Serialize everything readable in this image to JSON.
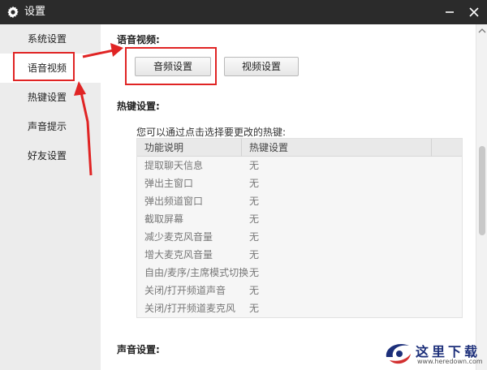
{
  "window": {
    "title": "设置"
  },
  "sidebar": {
    "items": [
      {
        "label": "系统设置",
        "active": false
      },
      {
        "label": "语音视频",
        "active": true
      },
      {
        "label": "热键设置",
        "active": false
      },
      {
        "label": "声音提示",
        "active": false
      },
      {
        "label": "好友设置",
        "active": false
      }
    ]
  },
  "voice_video": {
    "title": "语音视频:",
    "audio_button": "音频设置",
    "video_button": "视频设置"
  },
  "hotkeys": {
    "title": "热键设置:",
    "hint": "您可以通过点击选择要更改的热键:",
    "columns": [
      "功能说明",
      "热键设置"
    ],
    "rows": [
      {
        "function": "提取聊天信息",
        "key": "无"
      },
      {
        "function": "弹出主窗口",
        "key": "无"
      },
      {
        "function": "弹出频道窗口",
        "key": "无"
      },
      {
        "function": "截取屏幕",
        "key": "无"
      },
      {
        "function": "减少麦克风音量",
        "key": "无"
      },
      {
        "function": "增大麦克风音量",
        "key": "无"
      },
      {
        "function": "自由/麦序/主席模式切换",
        "key": "无"
      },
      {
        "function": "关闭/打开频道声音",
        "key": "无"
      },
      {
        "function": "关闭/打开频道麦克风",
        "key": "无"
      }
    ]
  },
  "sound": {
    "title": "声音设置:"
  },
  "watermark": {
    "text": "这里下载",
    "url": "www.heredown.com"
  },
  "colors": {
    "titlebar": "#2b2b2b",
    "sidebar": "#ececec",
    "annotation": "#e02424",
    "watermark": "#1c2f7a"
  }
}
